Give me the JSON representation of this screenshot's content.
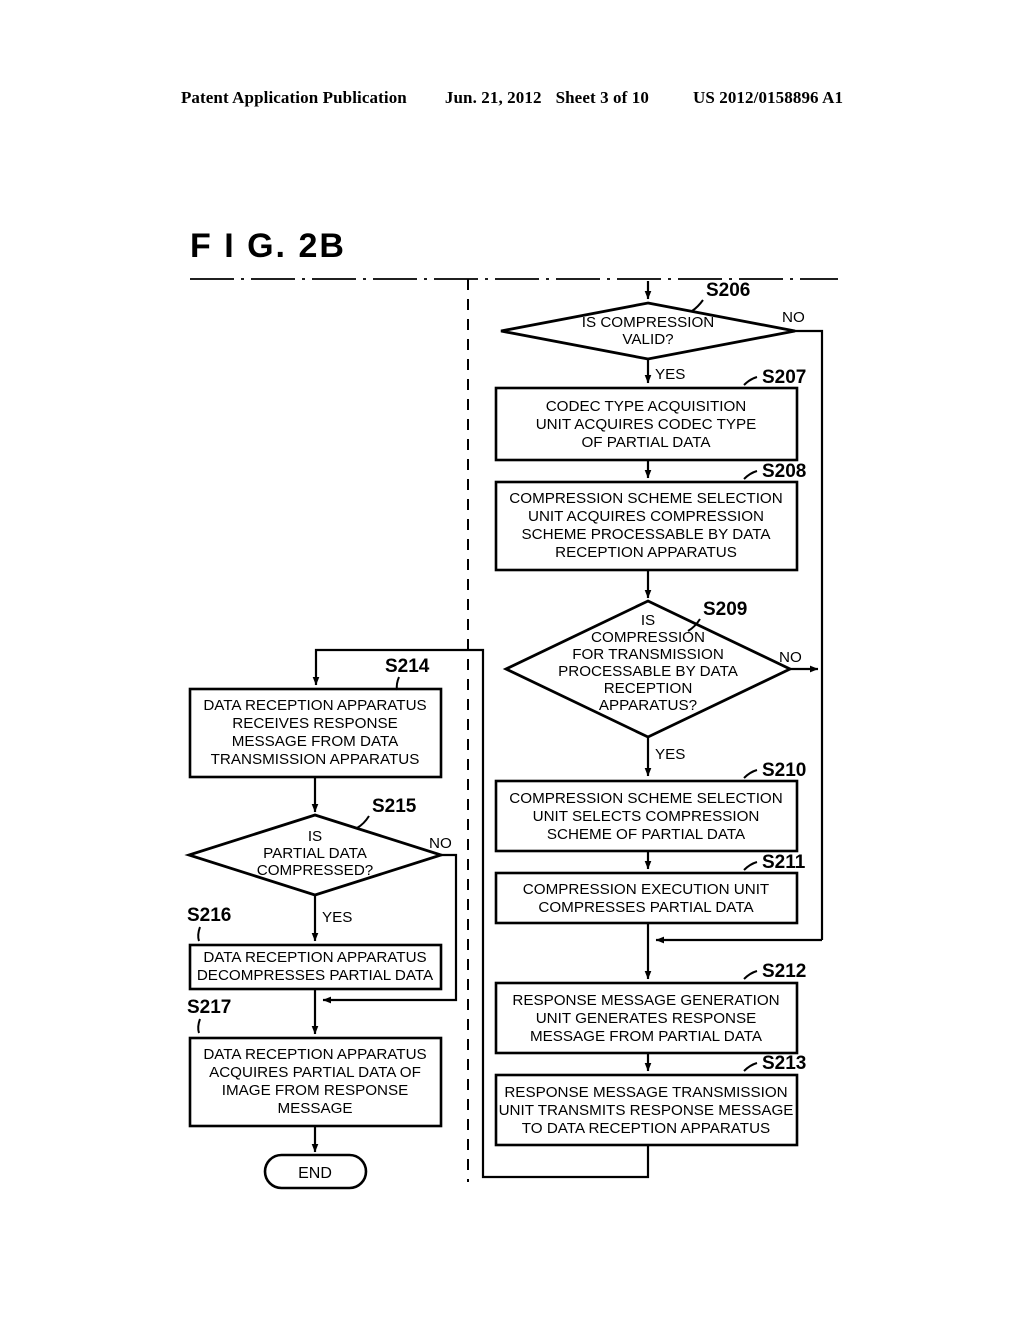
{
  "header": {
    "publication": "Patent Application Publication",
    "date": "Jun. 21, 2012",
    "sheet": "Sheet 3 of 10",
    "docnum": "US 2012/0158896 A1"
  },
  "figure": {
    "title": "F I G.  2B"
  },
  "end_node": {
    "label": "END"
  },
  "branch_labels": {
    "yes": "YES",
    "no": "NO"
  },
  "steps": {
    "s206": {
      "id": "S206",
      "type": "decision",
      "lines": [
        "IS COMPRESSION",
        "VALID?"
      ],
      "yes": "YES",
      "no": "NO"
    },
    "s207": {
      "id": "S207",
      "type": "process",
      "lines": [
        "CODEC TYPE ACQUISITION",
        "UNIT ACQUIRES CODEC TYPE",
        "OF PARTIAL DATA"
      ]
    },
    "s208": {
      "id": "S208",
      "type": "process",
      "lines": [
        "COMPRESSION SCHEME SELECTION",
        "UNIT ACQUIRES COMPRESSION",
        "SCHEME PROCESSABLE BY DATA",
        "RECEPTION APPARATUS"
      ]
    },
    "s209": {
      "id": "S209",
      "type": "decision",
      "lines": [
        "IS",
        "COMPRESSION",
        "FOR TRANSMISSION",
        "PROCESSABLE BY DATA",
        "RECEPTION",
        "APPARATUS?"
      ],
      "yes": "YES",
      "no": "NO"
    },
    "s210": {
      "id": "S210",
      "type": "process",
      "lines": [
        "COMPRESSION SCHEME SELECTION",
        "UNIT SELECTS COMPRESSION",
        "SCHEME OF PARTIAL DATA"
      ]
    },
    "s211": {
      "id": "S211",
      "type": "process",
      "lines": [
        "COMPRESSION EXECUTION UNIT",
        "COMPRESSES PARTIAL DATA"
      ]
    },
    "s212": {
      "id": "S212",
      "type": "process",
      "lines": [
        "RESPONSE MESSAGE GENERATION",
        "UNIT GENERATES RESPONSE",
        "MESSAGE FROM PARTIAL DATA"
      ]
    },
    "s213": {
      "id": "S213",
      "type": "process",
      "lines": [
        "RESPONSE MESSAGE TRANSMISSION",
        "UNIT TRANSMITS RESPONSE MESSAGE",
        "TO DATA RECEPTION APPARATUS"
      ]
    },
    "s214": {
      "id": "S214",
      "type": "process",
      "lines": [
        "DATA RECEPTION APPARATUS",
        "RECEIVES RESPONSE",
        "MESSAGE FROM DATA",
        "TRANSMISSION APPARATUS"
      ]
    },
    "s215": {
      "id": "S215",
      "type": "decision",
      "lines": [
        "IS",
        "PARTIAL DATA",
        "COMPRESSED?"
      ],
      "yes": "YES",
      "no": "NO"
    },
    "s216": {
      "id": "S216",
      "type": "process",
      "lines": [
        "DATA RECEPTION APPARATUS",
        "DECOMPRESSES PARTIAL DATA"
      ]
    },
    "s217": {
      "id": "S217",
      "type": "process",
      "lines": [
        "DATA RECEPTION APPARATUS",
        "ACQUIRES PARTIAL DATA OF",
        "IMAGE FROM RESPONSE",
        "MESSAGE"
      ]
    }
  },
  "colors": {
    "ink": "#000000",
    "paper": "#ffffff"
  }
}
